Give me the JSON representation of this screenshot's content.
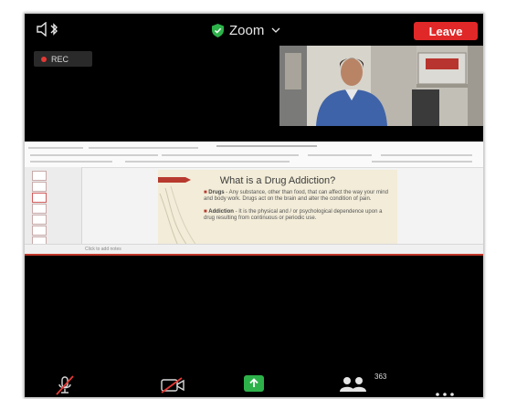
{
  "header": {
    "app_title": "Zoom",
    "leave_label": "Leave",
    "security_icon": "shield-check-icon",
    "audio_icon": "speaker-bluetooth-icon"
  },
  "recording": {
    "label": "REC"
  },
  "shared_slide": {
    "title": "What is a Drug Addiction?",
    "bullets": [
      {
        "term": "Drugs",
        "text": " - Any substance, other than food, that can affect the way your mind and body work. Drugs act on the brain and alter the condition of pain."
      },
      {
        "term": "Addiction",
        "text": " - It is the physical and / or psychological dependence upon a drug resulting from continuous or periodic use."
      }
    ],
    "status_text": "Click to add notes"
  },
  "toolbar": {
    "participants_count": "363",
    "icons": [
      "mic-muted-icon",
      "video-off-icon",
      "share-screen-icon",
      "participants-icon",
      "more-icon"
    ]
  },
  "colors": {
    "leave": "#e02828",
    "share": "#2db24a",
    "shield": "#2db24a",
    "rec_dot": "#e53935"
  }
}
